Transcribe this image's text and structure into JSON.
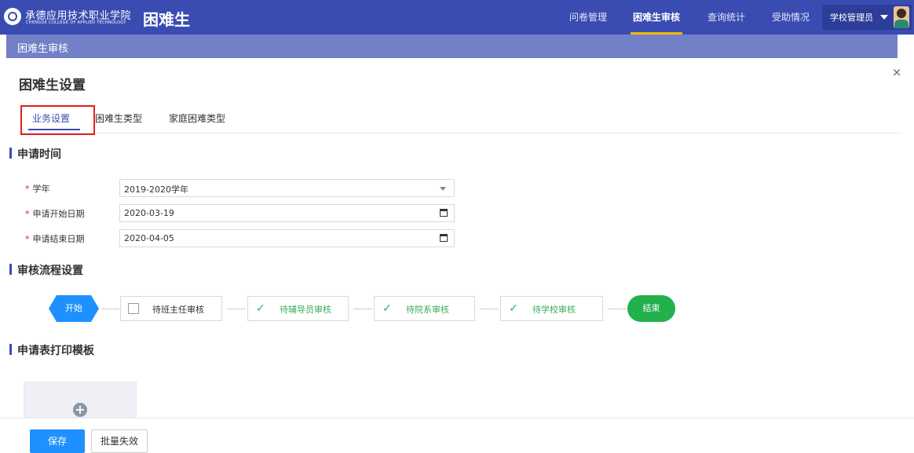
{
  "header": {
    "school_name_cn": "承德应用技术职业学院",
    "school_name_en": "CHENGDE COLLEGE OF APPLIED TECHNOLOGY",
    "app_title": "困难生",
    "nav": [
      {
        "label": "问卷管理",
        "active": false
      },
      {
        "label": "困难生审核",
        "active": true
      },
      {
        "label": "查询统计",
        "active": false
      },
      {
        "label": "受助情况",
        "active": false
      }
    ],
    "user": "学校管理员"
  },
  "breadcrumb": "困难生审核",
  "dialog": {
    "title": "困难生设置",
    "close_icon": "close-icon",
    "tabs": [
      "业务设置",
      "困难生类型",
      "家庭困难类型"
    ],
    "active_tab": "业务设置"
  },
  "apply_time": {
    "heading": "申请时间",
    "fields": [
      {
        "label": "学年",
        "value": "2019-2020学年",
        "required": "*",
        "kind": "select"
      },
      {
        "label": "申请开始日期",
        "value": "2020-03-19",
        "required": "*",
        "kind": "date"
      },
      {
        "label": "申请结束日期",
        "value": "2020-04-05",
        "required": "*",
        "kind": "date"
      }
    ]
  },
  "flow": {
    "heading": "审核流程设置",
    "start": "开始",
    "steps": [
      {
        "label": "待班主任审核",
        "checked": false
      },
      {
        "label": "待辅导员审核",
        "checked": true
      },
      {
        "label": "待院系审核",
        "checked": true
      },
      {
        "label": "待学校审核",
        "checked": true
      }
    ],
    "end": "结束",
    "check_icon": "check-icon",
    "done_color": "#3eae5e"
  },
  "template": {
    "heading": "申请表打印模板",
    "add_icon": "plus-circle-icon"
  },
  "footer": {
    "save": "保存",
    "batch_invalidate": "批量失效"
  },
  "colors": {
    "primary": "#3a4cb2",
    "accent": "#1e90ff",
    "success": "#22b14c",
    "highlight": "#e02020"
  }
}
